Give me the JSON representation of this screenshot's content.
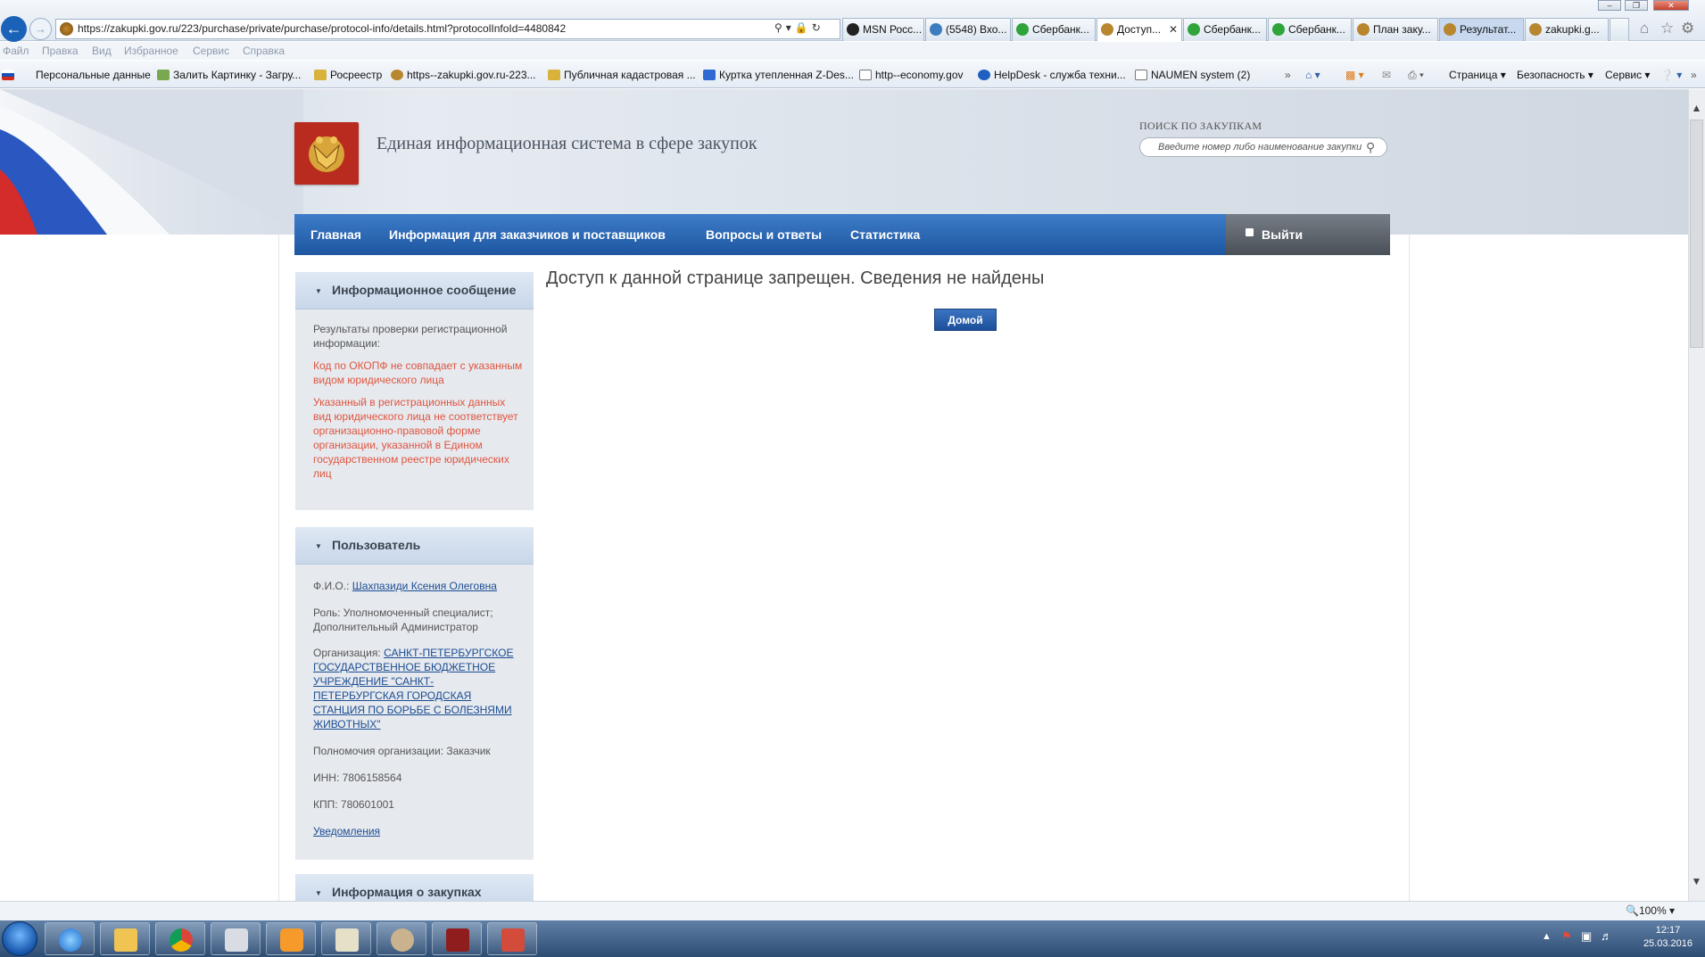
{
  "browser": {
    "url": "https://zakupki.gov.ru/223/purchase/private/purchase/protocol-info/details.html?protocolInfoId=4480842",
    "tabs": [
      {
        "label": "MSN Росс..."
      },
      {
        "label": "(5548) Вхо..."
      },
      {
        "label": "Сбербанк..."
      },
      {
        "label": "Доступ..."
      },
      {
        "label": "Сбербанк..."
      },
      {
        "label": "Сбербанк..."
      },
      {
        "label": "План заку..."
      },
      {
        "label": "Результат..."
      },
      {
        "label": "zakupki.g..."
      }
    ],
    "menu": [
      "Файл",
      "Правка",
      "Вид",
      "Избранное",
      "Сервис",
      "Справка"
    ],
    "favorites": [
      "Персональные данные",
      "Залить Картинку - Загру...",
      "Росреестр",
      "https--zakupki.gov.ru-223...",
      "Публичная кадастровая ...",
      "Куртка утепленная Z-Des...",
      "http--economy.gov",
      "HelpDesk - служба техни...",
      "NAUMEN system (2)"
    ],
    "command_bar": {
      "page": "Страница",
      "security": "Безопасность",
      "service": "Сервис"
    },
    "zoom": "100%"
  },
  "site": {
    "title": "Единая информационная система в сфере закупок",
    "search_label": "ПОИСК ПО ЗАКУПКАМ",
    "search_placeholder": "Введите номер либо наименование закупки"
  },
  "nav": {
    "items": [
      "Главная",
      "Информация для заказчиков и поставщиков",
      "Вопросы и ответы",
      "Статистика"
    ],
    "exit": "Выйти"
  },
  "info_panel": {
    "title": "Информационное сообщение",
    "intro": "Результаты проверки регистрационной информации:",
    "error1": "Код по ОКОПФ не совпадает с указанным видом юридического лица",
    "error2": "Указанный в регистрационных данных вид юридического лица не соответствует организационно-правовой форме организации, указанной в Едином государственном реестре юридических лиц"
  },
  "user_panel": {
    "title": "Пользователь",
    "fio_label": "Ф.И.О.:",
    "fio": "Шахпазиди Ксения Олеговна",
    "role": "Роль: Уполномоченный специалист; Дополнительный Администратор",
    "org_label": "Организация:",
    "org": "САНКТ-ПЕТЕРБУРГСКОЕ ГОСУДАРСТВЕННОЕ БЮДЖЕТНОЕ УЧРЕЖДЕНИЕ \"САНКТ-ПЕТЕРБУРГСКАЯ ГОРОДСКАЯ СТАНЦИЯ ПО БОРЬБЕ С БОЛЕЗНЯМИ ЖИВОТНЫХ\"",
    "powers": "Полномочия организации: Заказчик",
    "inn": "ИНН: 7806158564",
    "kpp": "КПП: 780601001",
    "notifications": "Уведомления"
  },
  "purchases_panel": {
    "title": "Информация о закупках"
  },
  "main": {
    "error_title": "Доступ к данной странице запрещен. Сведения не найдены",
    "home_button": "Домой"
  },
  "system": {
    "time": "12:17",
    "date": "25.03.2016"
  }
}
